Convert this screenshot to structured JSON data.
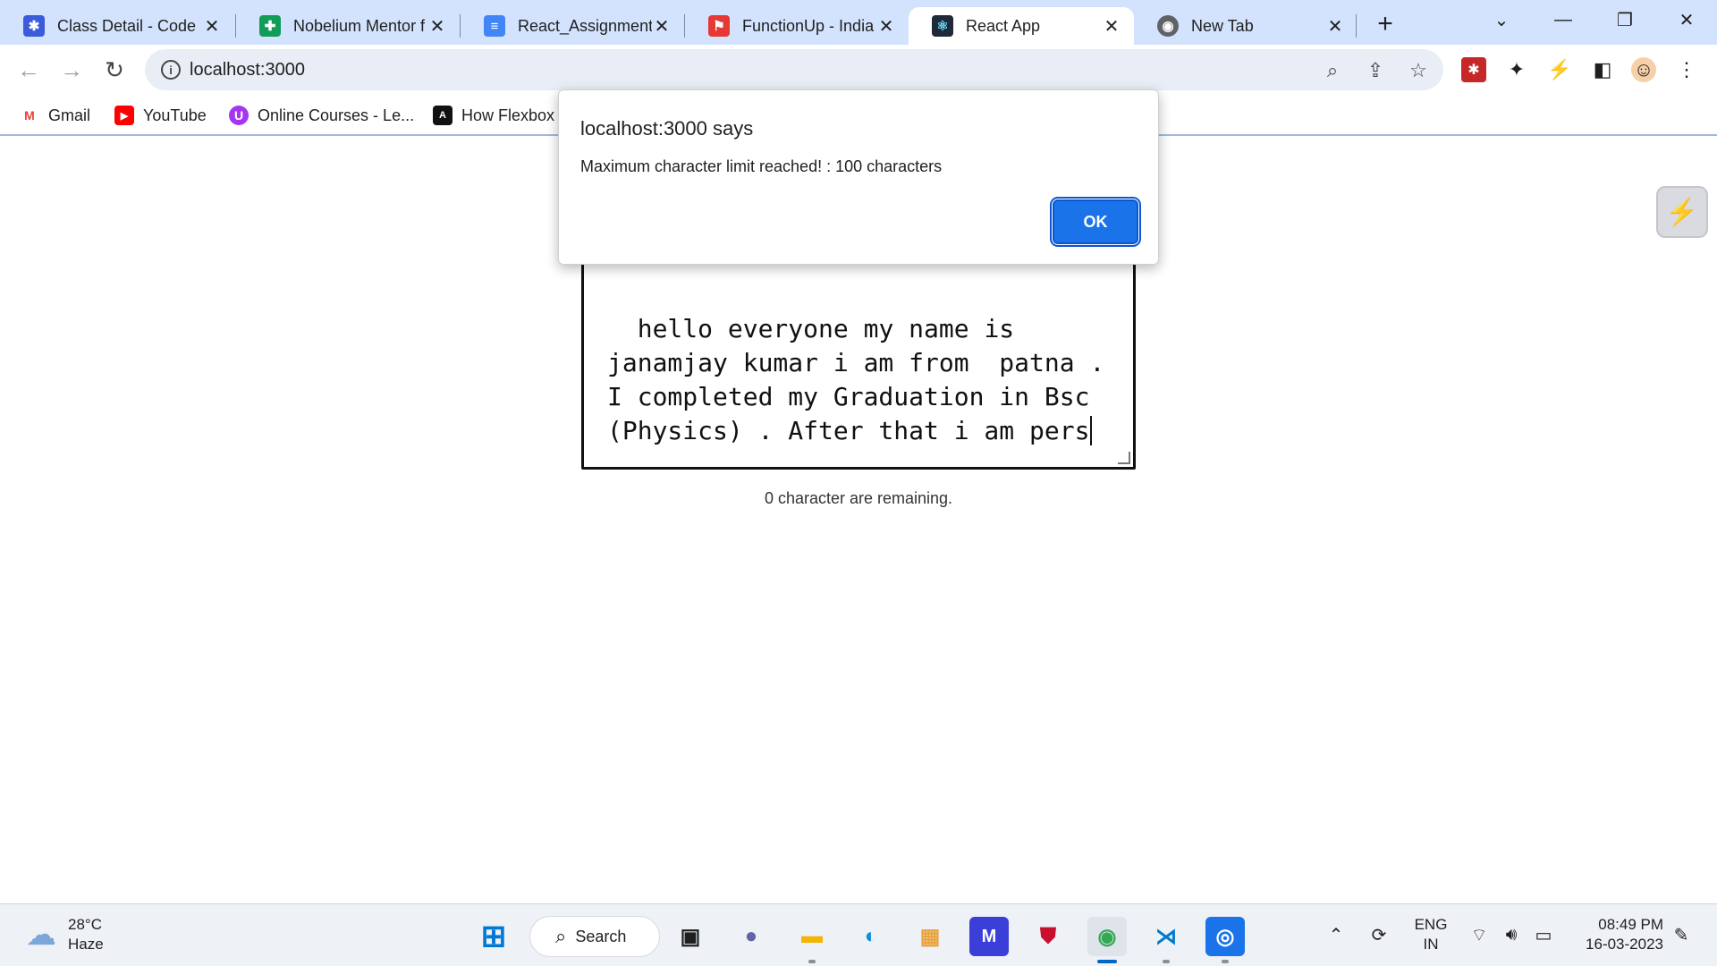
{
  "tabs": [
    {
      "title": "Class Detail - Code",
      "favicon": "codeade-icon",
      "color": "#3b5bdb"
    },
    {
      "title": "Nobelium Mentor f",
      "favicon": "sheets-icon",
      "color": "#0f9d58"
    },
    {
      "title": "React_Assignments",
      "favicon": "docs-icon",
      "color": "#4285f4"
    },
    {
      "title": "FunctionUp - India",
      "favicon": "functionup-icon",
      "color": "#e53935"
    },
    {
      "title": "React App",
      "favicon": "react-icon",
      "color": "#1f2937",
      "active": true
    },
    {
      "title": "New Tab",
      "favicon": "chrome-icon",
      "color": "#5f6368"
    }
  ],
  "toolbar": {
    "url": "localhost:3000"
  },
  "bookmarks": [
    {
      "label": "Gmail",
      "icon": "gmail-icon",
      "color": "#ea4335"
    },
    {
      "label": "YouTube",
      "icon": "youtube-icon",
      "color": "#ff0000"
    },
    {
      "label": "Online Courses - Le...",
      "icon": "udemy-icon",
      "color": "#a435f0"
    },
    {
      "label": "How Flexbox",
      "icon": "flexbox-icon",
      "color": "#111111"
    }
  ],
  "dialog": {
    "title": "localhost:3000 says",
    "message": "Maximum character limit reached! : 100 characters",
    "ok_label": "OK"
  },
  "editor": {
    "text": "hello everyone my name is janamjay kumar i am from  patna . I completed my Graduation in Bsc (Physics) . After that i am pers",
    "remaining": "0 character are remaining."
  },
  "taskbar": {
    "temperature": "28°C",
    "condition": "Haze",
    "search_label": "Search",
    "language_1": "ENG",
    "language_2": "IN",
    "time": "08:49 PM",
    "date": "16-03-2023"
  }
}
